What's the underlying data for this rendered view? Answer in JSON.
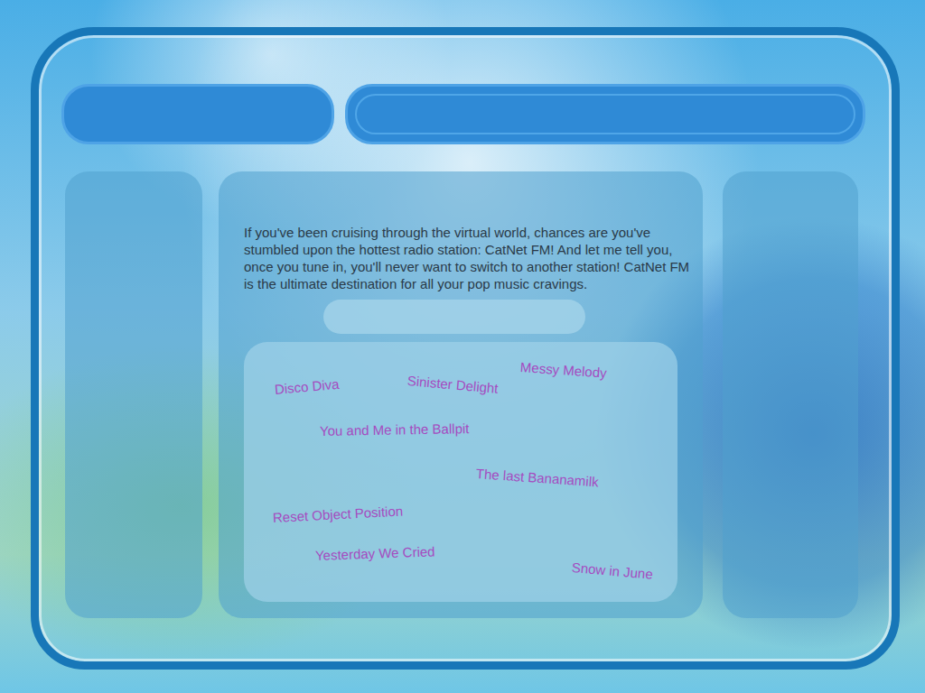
{
  "station": {
    "intro": "If you've been cruising through the virtual world, chances are you've stumbled upon the hottest radio station: CatNet FM! And let me tell you, once you tune in, you'll never want to switch to another station! CatNet FM is the ultimate destination for all your pop music cravings."
  },
  "songs": [
    {
      "title": "Disco Diva"
    },
    {
      "title": "Sinister Delight"
    },
    {
      "title": "Messy Melody"
    },
    {
      "title": "You and Me in the Ballpit"
    },
    {
      "title": "The last Bananamilk"
    },
    {
      "title": "Reset Object Position"
    },
    {
      "title": "Yesterday We Cried"
    },
    {
      "title": "Snow in June"
    }
  ]
}
